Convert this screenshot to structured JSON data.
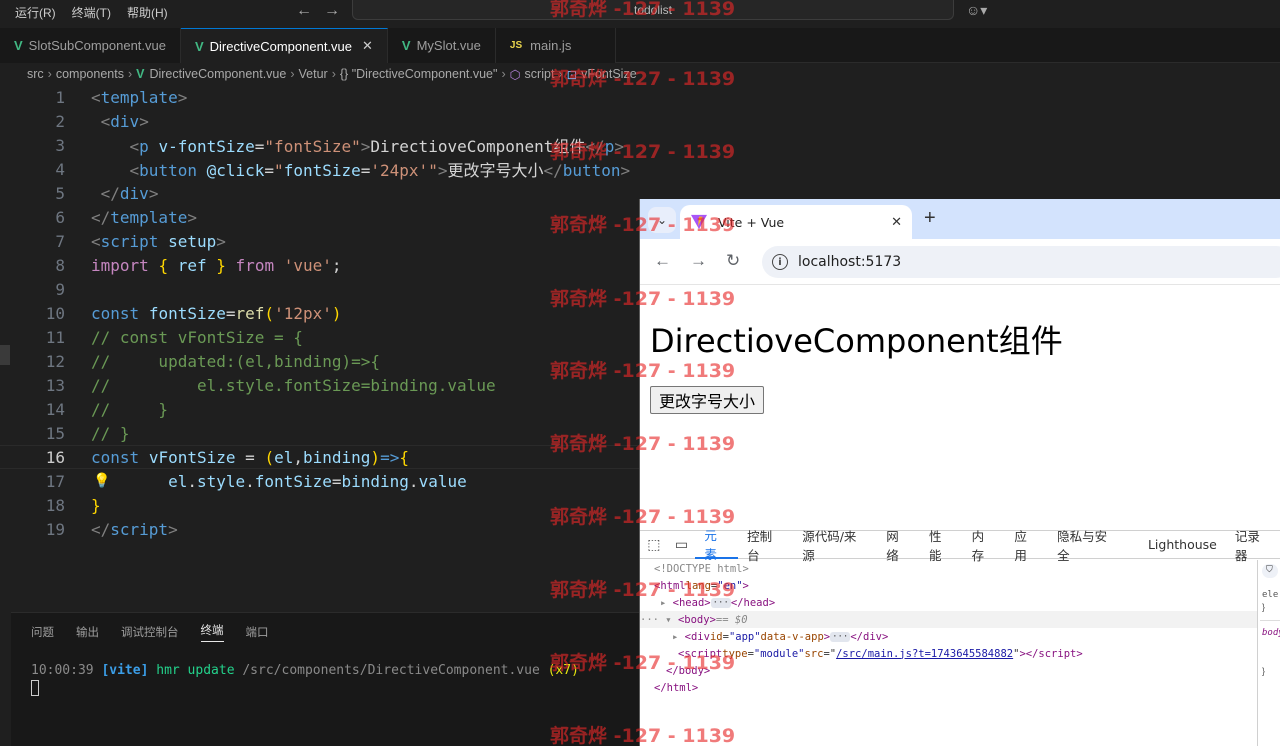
{
  "menubar": {
    "items": [
      "运行(R)",
      "终端(T)",
      "帮助(H)"
    ],
    "search_text": "todolist"
  },
  "tabs": [
    {
      "label": "SlotSubComponent.vue",
      "icon": "vue-icon",
      "active": false
    },
    {
      "label": "DirectiveComponent.vue",
      "icon": "vue-icon",
      "active": true
    },
    {
      "label": "MySlot.vue",
      "icon": "vue-icon",
      "active": false
    },
    {
      "label": "main.js",
      "icon": "js-icon",
      "active": false
    }
  ],
  "breadcrumb": {
    "items": [
      "src",
      "components",
      "DirectiveComponent.vue",
      "Vetur",
      "{} \"DirectiveComponent.vue\"",
      "script",
      "vFontSize"
    ]
  },
  "editor": {
    "line_numbers": [
      "1",
      "2",
      "3",
      "4",
      "5",
      "6",
      "7",
      "8",
      "9",
      "10",
      "11",
      "12",
      "13",
      "14",
      "15",
      "16",
      "17",
      "18",
      "19"
    ],
    "current_line": "16"
  },
  "panel": {
    "tabs": [
      "问题",
      "输出",
      "调试控制台",
      "终端",
      "端口"
    ],
    "active_tab": "终端",
    "terminal": {
      "time": "10:00:39",
      "tag": "[vite]",
      "msg": "hmr update",
      "path": "/src/components/DirectiveComponent.vue",
      "count": "(x7)"
    }
  },
  "browser": {
    "tab_title": "Vite + Vue",
    "url": "localhost:5173",
    "page_heading": "DirectioveComponent组件",
    "page_button": "更改字号大小",
    "devtools": {
      "tabs": [
        "元素",
        "控制台",
        "源代码/来源",
        "网络",
        "性能",
        "内存",
        "应用",
        "隐私与安全",
        "Lighthouse",
        "记录器"
      ],
      "active_tab": "元素",
      "side_tab": "样",
      "dom": {
        "doctype": "<!DOCTYPE html>",
        "html_open": "html",
        "lang_attr": "lang",
        "lang_val": "\"en\"",
        "head": "head",
        "body": "body",
        "body_marker": "== $0",
        "div_id_attr": "id",
        "div_id_val": "\"app\"",
        "div_data_attr": "data-v-app",
        "script_type_attr": "type",
        "script_type_val": "\"module\"",
        "script_src_attr": "src",
        "script_src_val": "/src/main.js?t=1743645584882",
        "body_close": "</body>",
        "html_close": "</html>"
      }
    }
  },
  "watermark": "郭奇烨 -127 - 1139",
  "colors": {
    "editor_bg": "#1f1f1f",
    "vue_green": "#41b883",
    "accent_blue": "#0078d4",
    "watermark_red": "#e62828"
  }
}
